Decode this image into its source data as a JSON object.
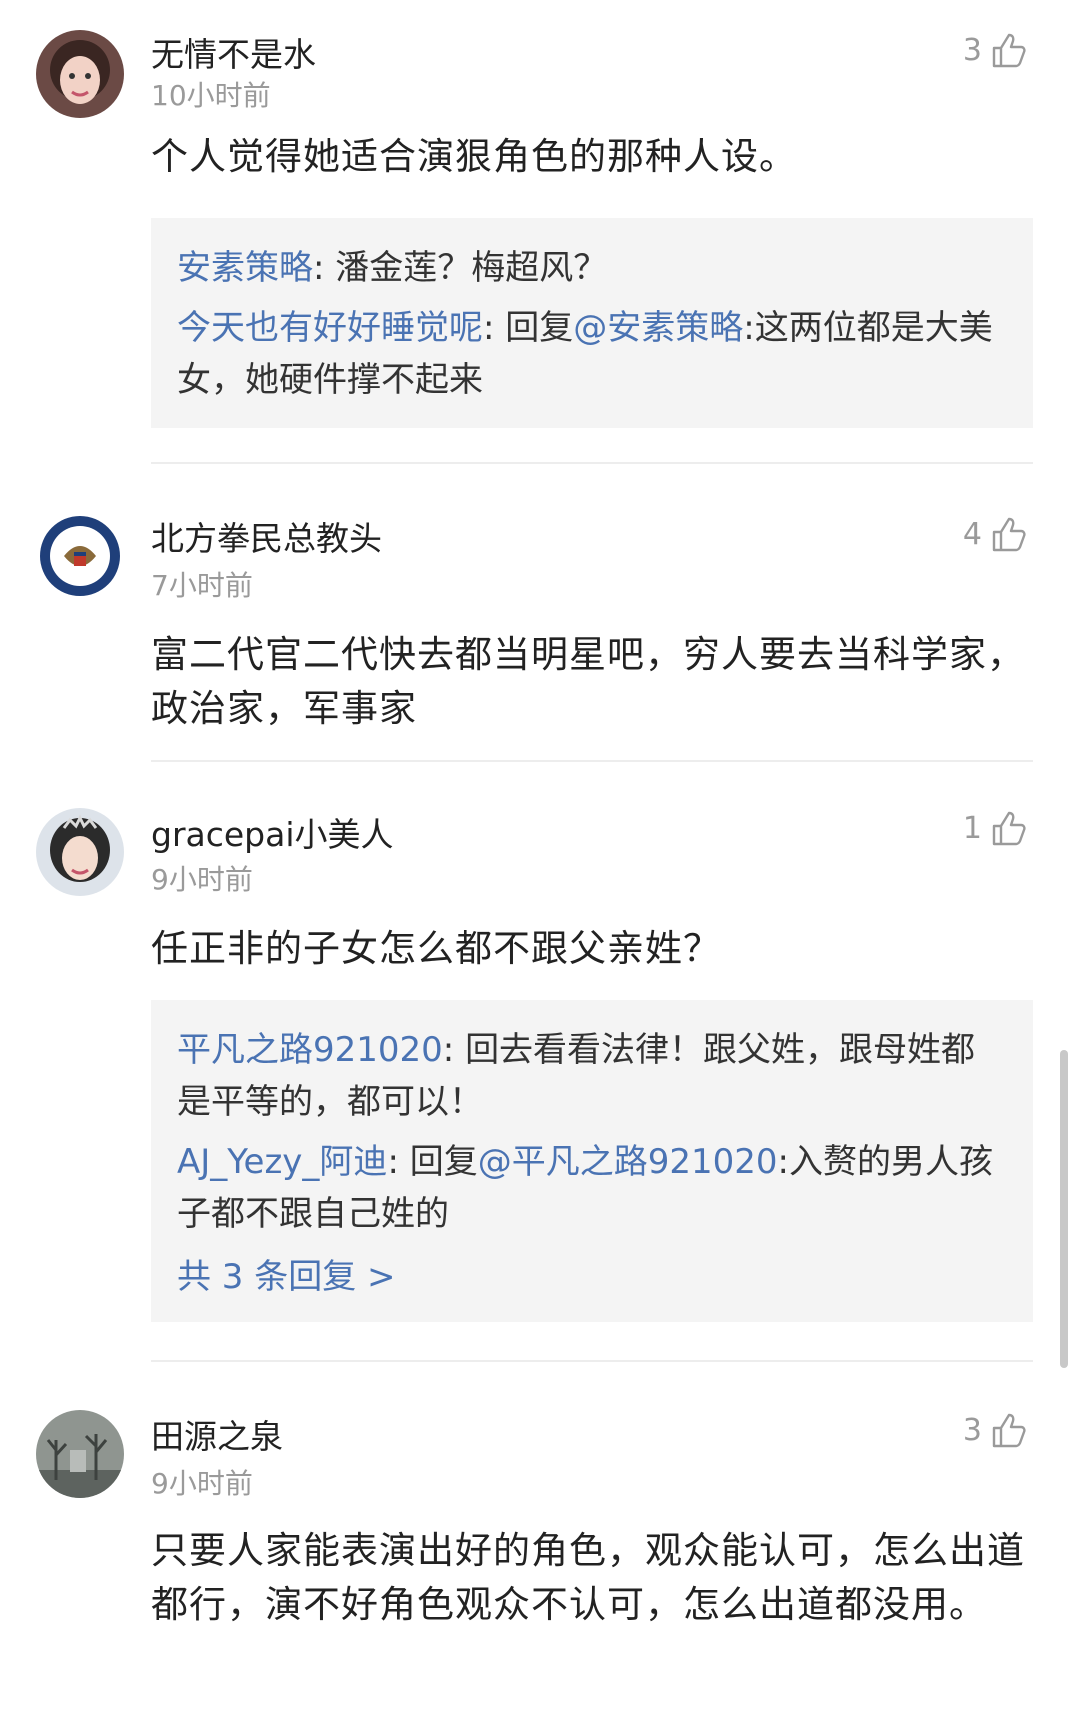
{
  "comments": [
    {
      "username": "无情不是水",
      "time": "10小时前",
      "likes": "3",
      "avatar_icon": "avatar-woman-curly-hair",
      "content": "个人觉得她适合演狠角色的那种人设。",
      "replies": [
        {
          "name": "安素策略",
          "sep": ": ",
          "text": "潘金莲？梅超风？"
        },
        {
          "name": "今天也有好好睡觉呢",
          "sep": ": 回复",
          "mention": "@安素策略",
          "text": ":这两位都是大美女，她硬件撑不起来"
        }
      ]
    },
    {
      "username": "北方拳民总教头",
      "time": "7小时前",
      "likes": "4",
      "avatar_icon": "avatar-eagle-seal",
      "content": "富二代官二代快去都当明星吧，穷人要去当科学家，政治家，军事家"
    },
    {
      "username": "gracepai小美人",
      "time": "9小时前",
      "likes": "1",
      "avatar_icon": "avatar-woman-tiara",
      "content": "任正非的子女怎么都不跟父亲姓？",
      "replies": [
        {
          "name": "平凡之路921020",
          "sep": ": ",
          "text": "回去看看法律！跟父姓，跟母姓都是平等的，都可以！"
        },
        {
          "name": "AJ_Yezy_阿迪",
          "sep": ": 回复",
          "mention": "@平凡之路921020",
          "text": ":入赘的男人孩子都不跟自己姓的"
        }
      ],
      "more": "共 3 条回复 >"
    },
    {
      "username": "田源之泉",
      "time": "9小时前",
      "likes": "3",
      "avatar_icon": "avatar-foggy-trees",
      "content": "只要人家能表演出好的角色，观众能认可，怎么出道都行，演不好角色观众不认可，怎么出道都没用。"
    }
  ],
  "icons": {
    "like": "thumbs-up-icon"
  },
  "colors": {
    "link": "#4a73b3",
    "time": "#9a9a9a",
    "reply_bg": "#f4f4f4"
  }
}
